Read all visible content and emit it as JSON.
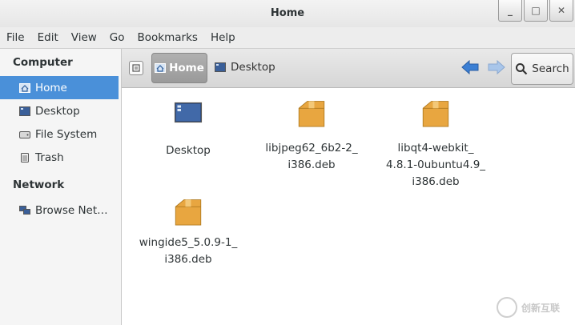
{
  "window": {
    "title": "Home",
    "buttons": [
      "minimize",
      "maximize",
      "close"
    ]
  },
  "menubar": [
    "File",
    "Edit",
    "View",
    "Go",
    "Bookmarks",
    "Help"
  ],
  "sidebar": {
    "sections": [
      {
        "header": "Computer",
        "items": [
          {
            "label": "Home",
            "icon": "home-icon",
            "active": true
          },
          {
            "label": "Desktop",
            "icon": "desktop-icon",
            "active": false
          },
          {
            "label": "File System",
            "icon": "drive-icon",
            "active": false
          },
          {
            "label": "Trash",
            "icon": "trash-icon",
            "active": false
          }
        ]
      },
      {
        "header": "Network",
        "items": [
          {
            "label": "Browse Net…",
            "icon": "network-icon",
            "active": false
          }
        ]
      }
    ]
  },
  "toolbar": {
    "breadcrumbs": [
      "Home",
      "Desktop"
    ],
    "search_label": "Search"
  },
  "files": [
    {
      "name": "Desktop",
      "icon": "desktop-folder-icon",
      "lines": [
        "Desktop"
      ]
    },
    {
      "name": "libjpeg62_6b2-2_i386.deb",
      "icon": "package-icon",
      "lines": [
        "libjpeg62_6b2-2_",
        "i386.deb"
      ]
    },
    {
      "name": "libqt4-webkit_4.8.1-0ubuntu4.9_i386.deb",
      "icon": "package-icon",
      "lines": [
        "libqt4-webkit_",
        "4.8.1-0ubuntu4.9_",
        "i386.deb"
      ]
    },
    {
      "name": "wingide5_5.0.9-1_i386.deb",
      "icon": "package-icon",
      "lines": [
        "wingide5_5.0.9-1_",
        "i386.deb"
      ]
    }
  ],
  "watermark": "创新互联",
  "colors": {
    "selection": "#4a90d9",
    "package": "#e8a640"
  }
}
